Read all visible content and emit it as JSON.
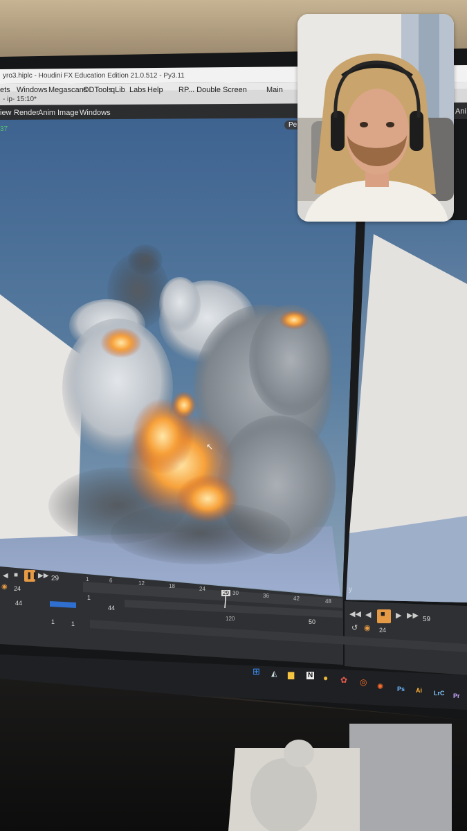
{
  "window": {
    "title": "yro3.hiplc - Houdini FX Education Edition 21.0.512 - Py3.11",
    "path": "- ip- 15:10*"
  },
  "menubar": {
    "items": [
      "ets",
      "Windows",
      "Megascans",
      "ODTools",
      "qLib",
      "Labs",
      "Help"
    ],
    "desktop": "RP... Double Screen",
    "desktop_right": "Main"
  },
  "viewer_menu": {
    "items": [
      "iew",
      "Render",
      "Anim",
      "Image",
      "Windows"
    ],
    "left_value": "37",
    "badge": "Pe",
    "right_cut": "Ani"
  },
  "timeline": {
    "current_frame": "29",
    "start_frame": "24",
    "range_start": "44",
    "range_one": "1",
    "marker_label": "44",
    "global_start": "1",
    "global_one": "1",
    "end_frame": "50",
    "ticks": [
      "1",
      "6",
      "12",
      "18",
      "24",
      "29",
      "30",
      "36",
      "42",
      "48"
    ],
    "range_tick": "120"
  },
  "timeline2": {
    "current_frame": "59",
    "start_frame": "24"
  },
  "viewport2": {
    "axis_label": "y"
  },
  "taskbar": {
    "apps": [
      "windows-start",
      "explorer",
      "file-manager",
      "notion",
      "cinema",
      "figma",
      "houdini",
      "photoshop",
      "illustrator",
      "lightroom",
      "premiere"
    ],
    "labels": {
      "ps": "Ps",
      "ai": "Ai",
      "lrc": "LrC",
      "pr": "Pr",
      "n": "N"
    }
  },
  "colors": {
    "sky": "#4a6f95",
    "fire": "#f08a2a",
    "smoke": "#9ba1a6",
    "timeline_bg": "#2e3033",
    "play_accent": "#f0a34a"
  }
}
